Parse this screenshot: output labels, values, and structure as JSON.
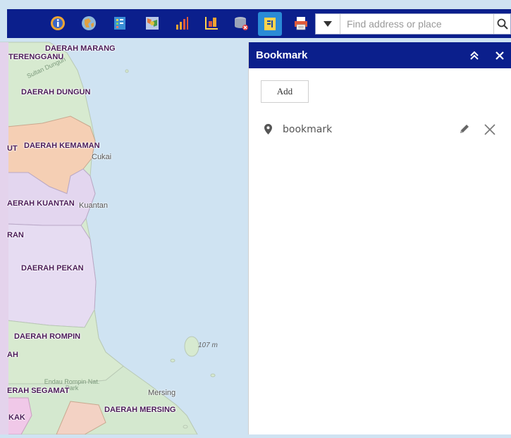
{
  "map": {
    "districts": [
      "DAERAH MARANG",
      "TERENGGANU",
      "DAERAH DUNGUN",
      "DAERAH KEMAMAN",
      "UT",
      "AERAH KUANTAN",
      "RAN",
      "DAERAH PEKAN",
      "DAERAH ROMPIN",
      "AH",
      "ERAH SEGAMAT",
      "DAERAH MERSING",
      "KAK"
    ],
    "towns": [
      "Cukai",
      "Kuantan",
      "Mersing"
    ],
    "parks": [
      "Sultan Dungun",
      "Endau Rompin Nat. Park"
    ],
    "elevation": "107 m",
    "colors": {
      "sea": "#cfe3f2",
      "land_green": "#d7ead0",
      "kemaman": "#f5cfb4",
      "kuantan": "#e3d6ef",
      "pekan": "#e6dcf2",
      "rompin": "#d8ead0",
      "district_label": "#4a1a57"
    }
  },
  "toolbar": {
    "background": "#0b1f8c",
    "icons": [
      "info-icon",
      "globe-icon",
      "legend-icon",
      "layer-list-icon",
      "chart-icon",
      "basemap-gallery-icon",
      "query-icon",
      "bookmark-icon",
      "print-icon"
    ],
    "active_icon": "bookmark-icon",
    "search": {
      "placeholder": "Find address or place",
      "value": ""
    }
  },
  "panel": {
    "title": "Bookmark",
    "add_label": "Add",
    "items": [
      {
        "name": "bookmark"
      }
    ]
  }
}
